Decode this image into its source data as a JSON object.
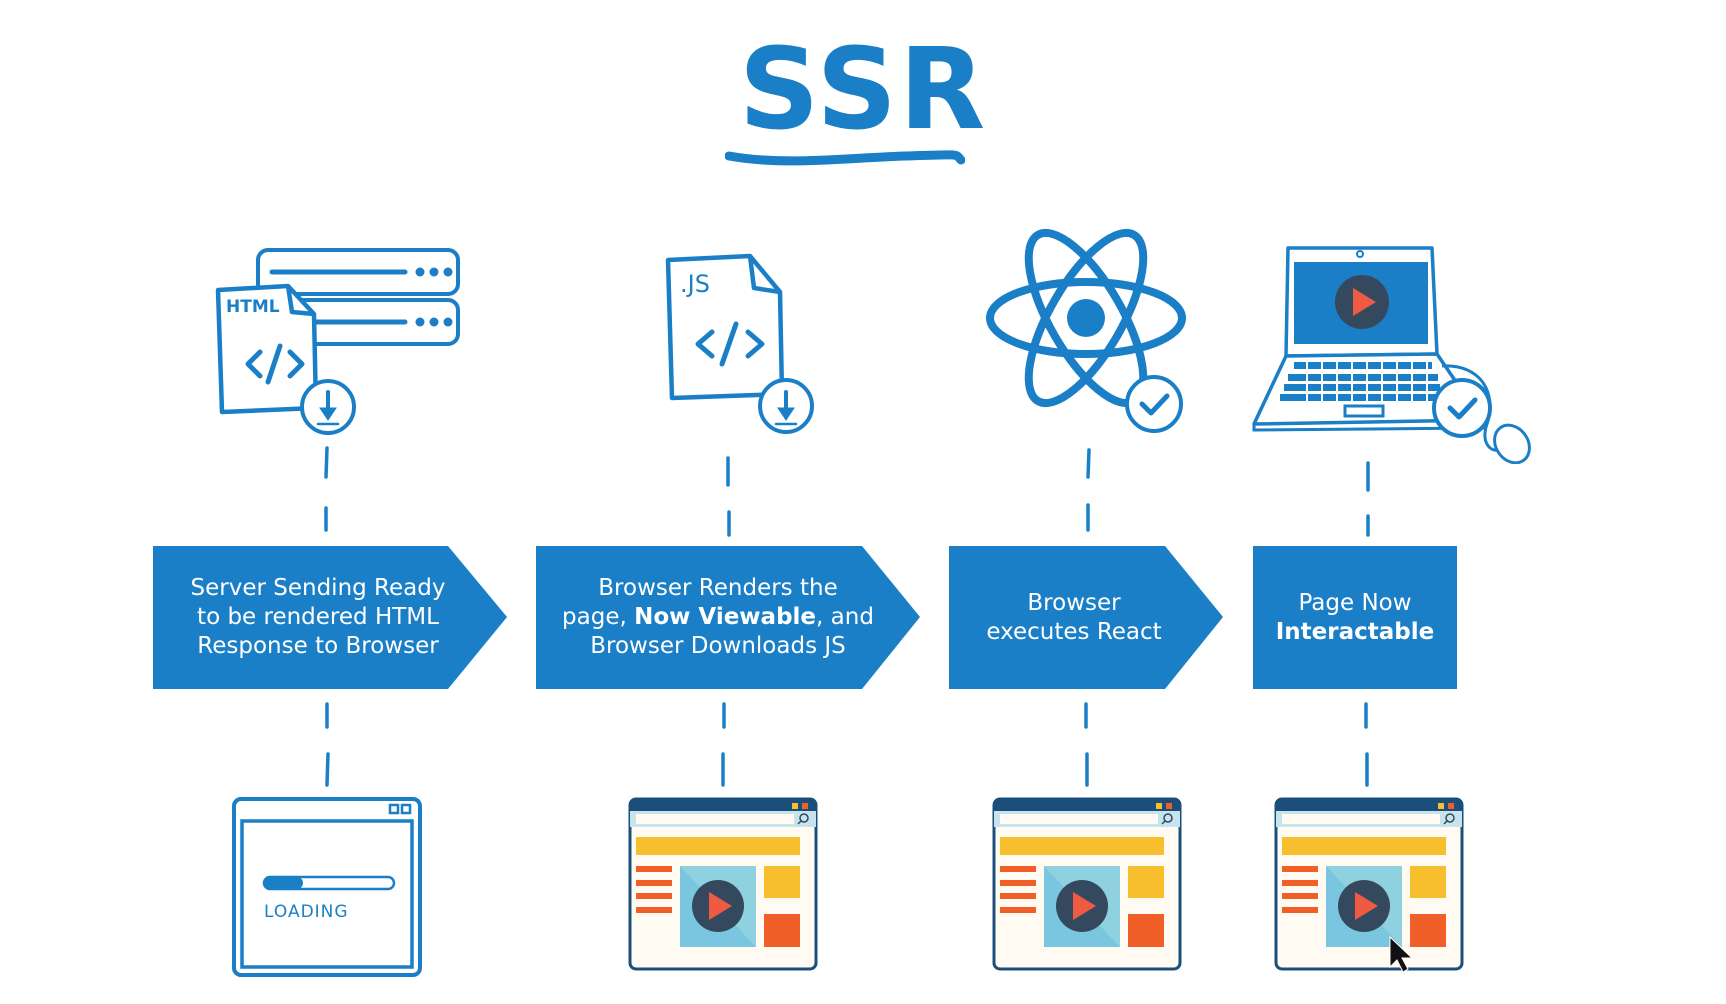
{
  "title": "SSR",
  "colors": {
    "primary": "#1a7fc7",
    "browser_frame": "#1b4f79",
    "yellow": "#f7be2d",
    "orange": "#f05f27",
    "video_bg": "#8fd1df",
    "play_circle": "#34495e",
    "play_triangle": "#ef5a43",
    "page_bg": "#fffbf3"
  },
  "steps": [
    {
      "id": "server-send",
      "icon": "html-file-server-download-icon",
      "icon_label": "HTML",
      "text_lines": [
        "Server Sending Ready",
        "to be rendered HTML",
        "Response to Browser"
      ],
      "bold_segments": [],
      "state_icon": "loading-browser-window-icon",
      "state_label": "LOADING",
      "loading_progress": 0.3
    },
    {
      "id": "browser-renders",
      "icon": "js-file-download-icon",
      "icon_label": ".JS",
      "text_line1": "Browser Renders the",
      "text_line2_pre": "page, ",
      "text_line2_bold": "Now Viewable",
      "text_line2_post": ", and",
      "text_line3": "Browser Downloads JS",
      "state_icon": "rendered-browser-window-icon"
    },
    {
      "id": "executes-react",
      "icon": "react-atom-check-icon",
      "text_lines": [
        "Browser",
        "executes React"
      ],
      "state_icon": "rendered-browser-window-icon"
    },
    {
      "id": "interactable",
      "icon": "laptop-check-mouse-icon",
      "text_line1": "Page Now",
      "text_line2_bold": "Interactable",
      "state_icon": "rendered-browser-window-cursor-icon"
    }
  ]
}
